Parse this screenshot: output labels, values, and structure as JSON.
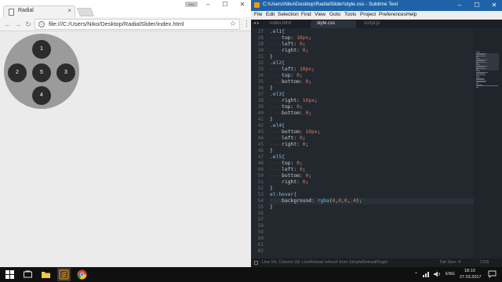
{
  "chrome": {
    "tab_title": "Radial",
    "tab_close": "×",
    "profile_label": "Niko",
    "controls": {
      "minimize": "–",
      "maximize": "☐",
      "close": "✕"
    },
    "nav": {
      "back": "←",
      "forward": "→",
      "reload": "↻"
    },
    "info_glyph": "i",
    "url": "file:///C:/Users/Niko/Desktop/RadialSlider/index.html",
    "star_glyph": "☆",
    "menu_glyph": "⋮",
    "page": {
      "buttons": [
        "1",
        "2",
        "5",
        "3",
        "4"
      ]
    }
  },
  "sublime": {
    "title": "C:\\Users\\Niko\\Desktop\\RadialSlider\\style.css - Sublime Text",
    "controls": {
      "minimize": "–",
      "maximize": "☐",
      "close": "✕"
    },
    "menu": [
      "File",
      "Edit",
      "Selection",
      "Find",
      "View",
      "Goto",
      "Tools",
      "Project",
      "Preferences",
      "Help"
    ],
    "tab_arrows": "◂ ▸",
    "tabs": [
      "index.html",
      "style.css",
      "script.js"
    ],
    "active_tab": "style.css",
    "first_line_number": 27,
    "last_line_number": 62,
    "current_line": 54,
    "code_lines": [
      ".el1{",
      "    top: 10px;",
      "    left: 0;",
      "    right: 0;",
      "}",
      ".el2{",
      "    left: 10px;",
      "    top: 0;",
      "    bottom: 0;",
      "}",
      ".el3{",
      "    right: 10px;",
      "    top: 0;",
      "    bottom: 0;",
      "}",
      ".el4{",
      "    bottom: 10px;",
      "    left: 0;",
      "    right: 0;",
      "}",
      ".el5{",
      "    top: 0;",
      "    left: 0;",
      "    bottom: 0;",
      "    right: 0;",
      "}",
      "el:hover{",
      "    background: rgba(0,0,0,.4);",
      "}",
      "",
      "",
      "",
      "",
      "",
      "",
      ""
    ],
    "status_left": "Line 54, Column 33; LiveReload refresh from SimpleReloadPlugin",
    "status_tab_size": "Tab Size: 4",
    "status_syntax": "CSS"
  },
  "taskbar": {
    "language": "ENG",
    "time": "18:10",
    "date": "27.03.2017"
  },
  "colors": {
    "sublime_titlebar": "#1e63a8",
    "radial_bg": "#9b9b9b",
    "radial_button": "#2c2c2c",
    "css_number": "#e07a5f",
    "css_function": "#5fbcd3",
    "css_selector": "#8fb9e0"
  }
}
